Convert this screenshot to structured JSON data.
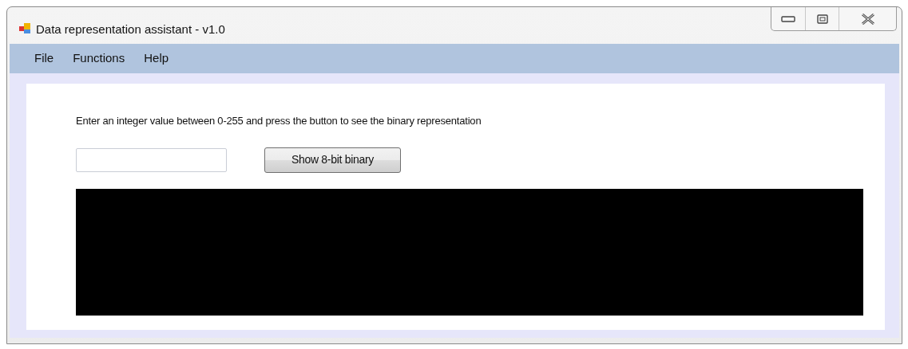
{
  "window": {
    "title": "Data representation assistant - v1.0"
  },
  "menu": [
    "File",
    "Functions",
    "Help"
  ],
  "instruction": "Enter an integer value between 0-255 and press the button to see the binary representation",
  "button": "Show 8-bit binary"
}
